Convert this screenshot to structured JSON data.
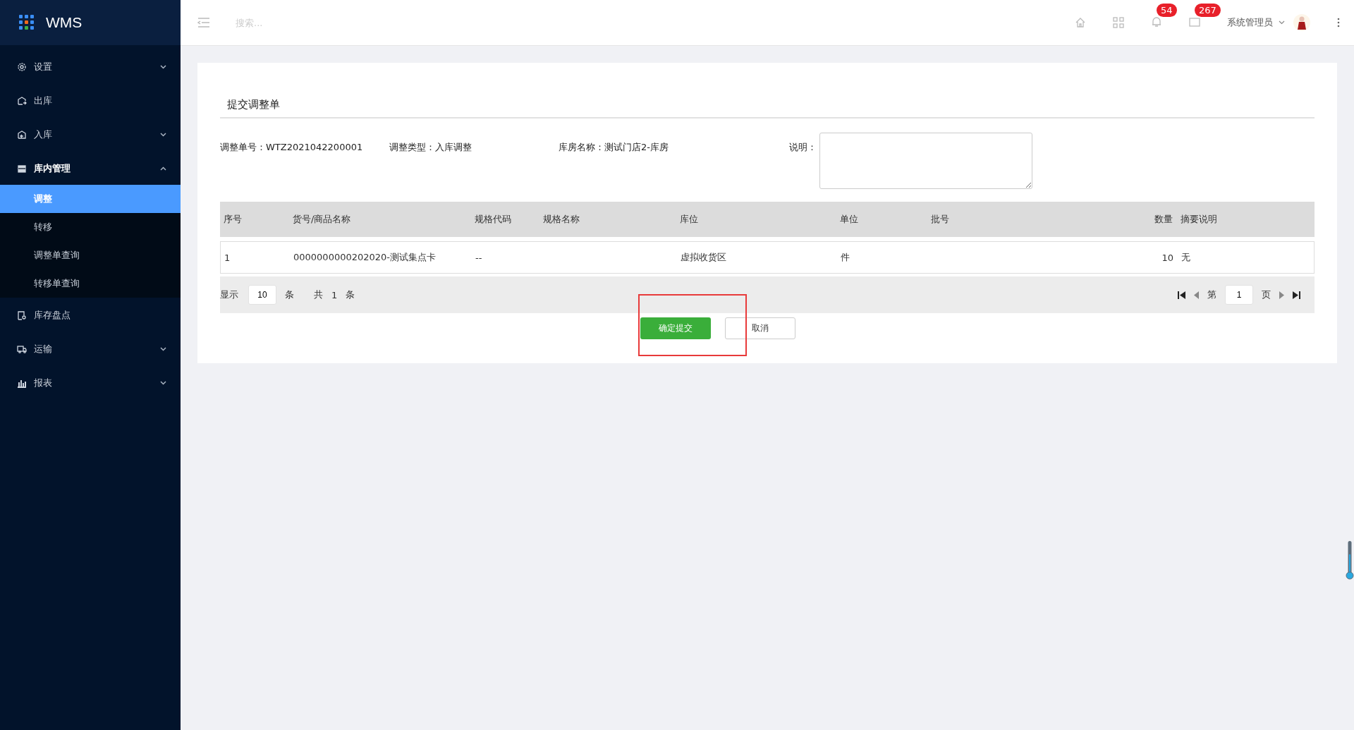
{
  "brand": "WMS",
  "sidebar": {
    "items": [
      {
        "label": "设置",
        "has_children": true,
        "expanded": false
      },
      {
        "label": "出库",
        "has_children": false,
        "expanded": false
      },
      {
        "label": "入库",
        "has_children": true,
        "expanded": false
      },
      {
        "label": "库内管理",
        "has_children": true,
        "expanded": true,
        "children": [
          {
            "label": "调整",
            "selected": true
          },
          {
            "label": "转移",
            "selected": false
          },
          {
            "label": "调整单查询",
            "selected": false
          },
          {
            "label": "转移单查询",
            "selected": false
          }
        ]
      },
      {
        "label": "库存盘点",
        "has_children": false,
        "expanded": false
      },
      {
        "label": "运输",
        "has_children": true,
        "expanded": false
      },
      {
        "label": "报表",
        "has_children": true,
        "expanded": false
      }
    ]
  },
  "topbar": {
    "search": {
      "placeholder": "搜索..."
    },
    "notifications": "54",
    "messages": "267",
    "user": "系统管理员"
  },
  "form": {
    "title": "提交调整单",
    "fields": [
      {
        "label": "调整单号：",
        "value": "WTZ2021042200001"
      },
      {
        "label": "调整类型：",
        "value": "入库调整"
      },
      {
        "label": "库房名称：",
        "value": "测试门店2-库房"
      }
    ],
    "note_label": "说明：",
    "table": {
      "columns": [
        "序号",
        "货号/商品名称",
        "规格代码",
        "规格名称",
        "库位",
        "单位",
        "批号",
        "数量",
        "摘要说明"
      ],
      "rows": [
        [
          "1",
          "0000000000202020-测试集点卡",
          "--",
          "",
          "虚拟收货区",
          "件",
          "",
          "10",
          "无"
        ]
      ]
    },
    "pager": {
      "show_label": "显示",
      "page_size": "10",
      "unit": "条",
      "total_label": "共",
      "total": "1",
      "total_unit": "条",
      "page_label": "第",
      "page": "1",
      "page_unit": "页"
    },
    "buttons": {
      "confirm": "确定提交",
      "cancel": "取消"
    }
  }
}
